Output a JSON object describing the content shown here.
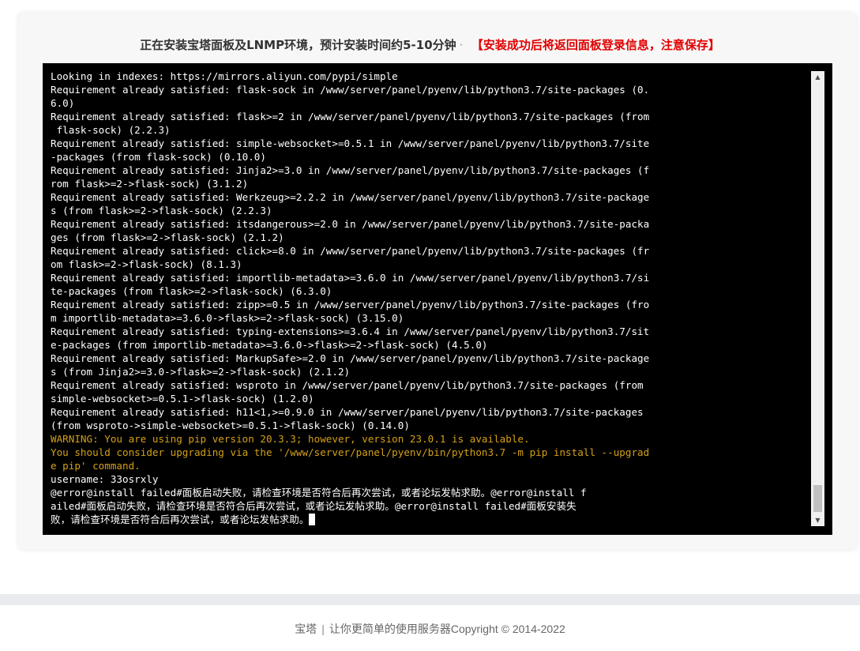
{
  "heading": {
    "title": "正在安装宝塔面板及LNMP环境，预计安装时间约5-10分钟",
    "dot": "·",
    "notice": "【安装成功后将返回面板登录信息，注意保存】"
  },
  "terminal": {
    "lines": [
      {
        "text": "Looking in indexes: https://mirrors.aliyun.com/pypi/simple",
        "type": "normal"
      },
      {
        "text": "Requirement already satisfied: flask-sock in /www/server/panel/pyenv/lib/python3.7/site-packages (0.",
        "type": "normal"
      },
      {
        "text": "6.0)",
        "type": "normal"
      },
      {
        "text": "Requirement already satisfied: flask>=2 in /www/server/panel/pyenv/lib/python3.7/site-packages (from",
        "type": "normal"
      },
      {
        "text": " flask-sock) (2.2.3)",
        "type": "normal"
      },
      {
        "text": "Requirement already satisfied: simple-websocket>=0.5.1 in /www/server/panel/pyenv/lib/python3.7/site",
        "type": "normal"
      },
      {
        "text": "-packages (from flask-sock) (0.10.0)",
        "type": "normal"
      },
      {
        "text": "Requirement already satisfied: Jinja2>=3.0 in /www/server/panel/pyenv/lib/python3.7/site-packages (f",
        "type": "normal"
      },
      {
        "text": "rom flask>=2->flask-sock) (3.1.2)",
        "type": "normal"
      },
      {
        "text": "Requirement already satisfied: Werkzeug>=2.2.2 in /www/server/panel/pyenv/lib/python3.7/site-package",
        "type": "normal"
      },
      {
        "text": "s (from flask>=2->flask-sock) (2.2.3)",
        "type": "normal"
      },
      {
        "text": "Requirement already satisfied: itsdangerous>=2.0 in /www/server/panel/pyenv/lib/python3.7/site-packa",
        "type": "normal"
      },
      {
        "text": "ges (from flask>=2->flask-sock) (2.1.2)",
        "type": "normal"
      },
      {
        "text": "Requirement already satisfied: click>=8.0 in /www/server/panel/pyenv/lib/python3.7/site-packages (fr",
        "type": "normal"
      },
      {
        "text": "om flask>=2->flask-sock) (8.1.3)",
        "type": "normal"
      },
      {
        "text": "Requirement already satisfied: importlib-metadata>=3.6.0 in /www/server/panel/pyenv/lib/python3.7/si",
        "type": "normal"
      },
      {
        "text": "te-packages (from flask>=2->flask-sock) (6.3.0)",
        "type": "normal"
      },
      {
        "text": "Requirement already satisfied: zipp>=0.5 in /www/server/panel/pyenv/lib/python3.7/site-packages (fro",
        "type": "normal"
      },
      {
        "text": "m importlib-metadata>=3.6.0->flask>=2->flask-sock) (3.15.0)",
        "type": "normal"
      },
      {
        "text": "Requirement already satisfied: typing-extensions>=3.6.4 in /www/server/panel/pyenv/lib/python3.7/sit",
        "type": "normal"
      },
      {
        "text": "e-packages (from importlib-metadata>=3.6.0->flask>=2->flask-sock) (4.5.0)",
        "type": "normal"
      },
      {
        "text": "Requirement already satisfied: MarkupSafe>=2.0 in /www/server/panel/pyenv/lib/python3.7/site-package",
        "type": "normal"
      },
      {
        "text": "s (from Jinja2>=3.0->flask>=2->flask-sock) (2.1.2)",
        "type": "normal"
      },
      {
        "text": "Requirement already satisfied: wsproto in /www/server/panel/pyenv/lib/python3.7/site-packages (from",
        "type": "normal"
      },
      {
        "text": "simple-websocket>=0.5.1->flask-sock) (1.2.0)",
        "type": "normal"
      },
      {
        "text": "Requirement already satisfied: h11<1,>=0.9.0 in /www/server/panel/pyenv/lib/python3.7/site-packages",
        "type": "normal"
      },
      {
        "text": "(from wsproto->simple-websocket>=0.5.1->flask-sock) (0.14.0)",
        "type": "normal"
      },
      {
        "text": "WARNING: You are using pip version 20.3.3; however, version 23.0.1 is available.",
        "type": "warn"
      },
      {
        "text": "You should consider upgrading via the '/www/server/panel/pyenv/bin/python3.7 -m pip install --upgrad",
        "type": "warn"
      },
      {
        "text": "e pip' command.",
        "type": "warn"
      },
      {
        "text": "username: 33osrxly",
        "type": "normal"
      },
      {
        "text": "@error@install failed#面板启动失败，请检查环境是否符合后再次尝试，或者论坛发帖求助。@error@install f",
        "type": "normal"
      },
      {
        "text": "ailed#面板启动失败，请检查环境是否符合后再次尝试，或者论坛发帖求助。@error@install failed#面板安装失",
        "type": "normal"
      },
      {
        "text": "败，请检查环境是否符合后再次尝试，或者论坛发帖求助。",
        "type": "normal",
        "cursor": true
      }
    ]
  },
  "scrollbar": {
    "up_arrow": "▲",
    "down_arrow": "▼"
  },
  "footer": {
    "brand": "宝塔",
    "separator": "|",
    "tagline": "让你更简单的使用服务器Copyright © 2014-2022"
  }
}
